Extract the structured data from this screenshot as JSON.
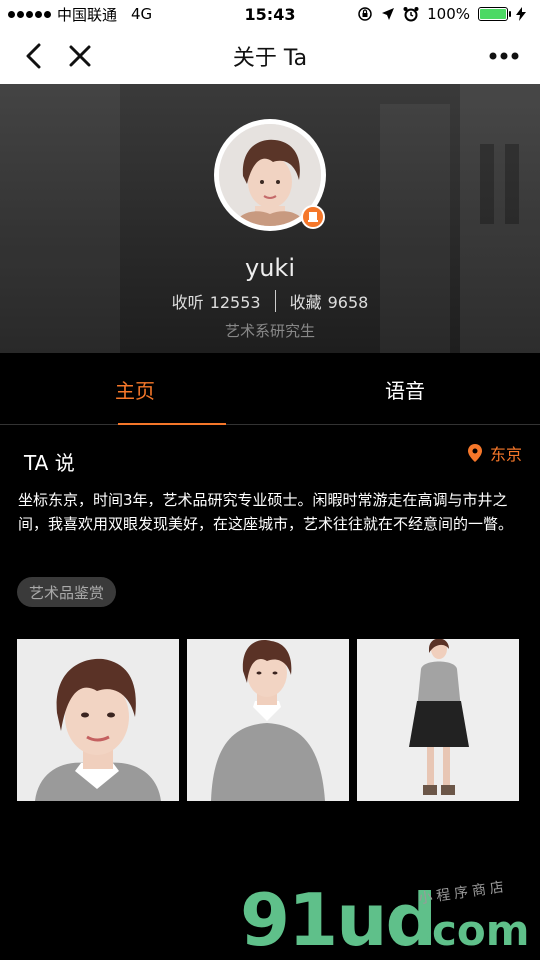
{
  "status_bar": {
    "carrier": "中国联通",
    "network": "4G",
    "time": "15:43",
    "battery": "100%"
  },
  "nav": {
    "title": "关于 Ta",
    "back_icon": "back-chevron-icon",
    "close_icon": "close-icon",
    "more_icon": "more-dots-icon"
  },
  "profile": {
    "name": "yuki",
    "listen_label": "收听",
    "listen_count": "12553",
    "fav_label": "收藏",
    "fav_count": "9658",
    "subtitle": "艺术系研究生"
  },
  "tabs": [
    {
      "label": "主页",
      "active": true
    },
    {
      "label": "语音",
      "active": false
    }
  ],
  "about": {
    "title": "TA 说",
    "location": "东京",
    "bio": "坐标东京，时间3年，艺术品研究专业硕士。闲暇时常游走在高调与市井之间，我喜欢用双眼发现美好，在这座城市，艺术往往就在不经意间的一瞥。",
    "tag": "艺术品鉴赏"
  },
  "watermark": {
    "main": "91ud",
    "suffix": ".com",
    "small": "小程序商店"
  },
  "colors": {
    "accent": "#f5772a",
    "watermark": "#5fc08a"
  }
}
